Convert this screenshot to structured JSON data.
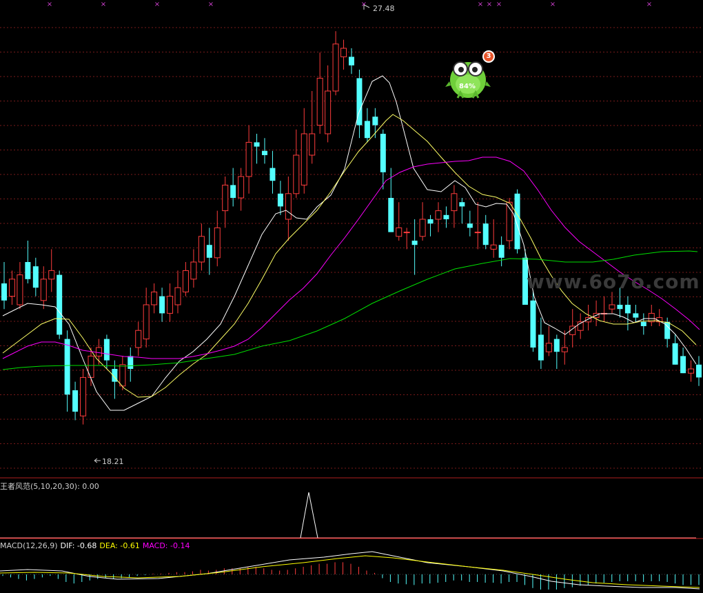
{
  "colors": {
    "up": "#ff3c3c",
    "down": "#54ffff",
    "ma5": "#ffffff",
    "ma10": "#ffff66",
    "ma20": "#ff00ff",
    "ma30": "#00e000",
    "grid": "#7a1a1a",
    "macd_dif": "#ffffff",
    "macd_dea": "#ffff00",
    "macd_label": "#ff00ff"
  },
  "price_axis": {
    "min": 17.0,
    "max": 28.0
  },
  "markers": {
    "high_label": "27.48",
    "low_label": "18.21"
  },
  "top_markers": [
    "×",
    "×",
    "×",
    "×",
    "×",
    "×",
    "×",
    "×",
    "×"
  ],
  "candles": [
    [
      21.5,
      21.1,
      22.0,
      20.9
    ],
    [
      21.2,
      21.6,
      21.8,
      21.0
    ],
    [
      21.0,
      21.7,
      22.0,
      20.9
    ],
    [
      22.0,
      21.6,
      22.5,
      21.5
    ],
    [
      21.9,
      21.4,
      22.1,
      21.2
    ],
    [
      21.1,
      21.6,
      21.9,
      20.9
    ],
    [
      21.6,
      21.8,
      22.3,
      21.3
    ],
    [
      21.7,
      20.3,
      21.8,
      20.2
    ],
    [
      20.2,
      18.9,
      20.4,
      18.5
    ],
    [
      19.0,
      18.5,
      19.2,
      18.3
    ],
    [
      18.4,
      19.3,
      19.5,
      18.2
    ],
    [
      19.3,
      19.8,
      20.0,
      19.1
    ],
    [
      19.8,
      20.0,
      20.2,
      19.6
    ],
    [
      20.2,
      19.7,
      20.3,
      19.5
    ],
    [
      19.5,
      19.2,
      19.7,
      18.8
    ],
    [
      19.1,
      19.6,
      19.8,
      19.0
    ],
    [
      19.8,
      19.5,
      20.0,
      19.2
    ],
    [
      20.0,
      20.4,
      20.6,
      19.8
    ],
    [
      20.2,
      21.0,
      21.4,
      20.0
    ],
    [
      21.0,
      21.3,
      21.5,
      20.8
    ],
    [
      21.2,
      20.8,
      21.4,
      20.6
    ],
    [
      20.8,
      21.2,
      21.5,
      20.6
    ],
    [
      21.0,
      21.4,
      21.8,
      20.8
    ],
    [
      21.3,
      21.8,
      22.0,
      21.2
    ],
    [
      21.6,
      22.0,
      22.3,
      21.4
    ],
    [
      22.0,
      22.6,
      22.9,
      21.8
    ],
    [
      22.4,
      22.1,
      22.8,
      21.7
    ],
    [
      22.1,
      22.8,
      23.2,
      21.9
    ],
    [
      23.2,
      23.8,
      24.0,
      22.8
    ],
    [
      23.8,
      23.5,
      24.2,
      23.3
    ],
    [
      23.5,
      24.0,
      24.2,
      23.2
    ],
    [
      24.0,
      24.8,
      25.2,
      23.6
    ],
    [
      24.8,
      24.7,
      25.0,
      24.3
    ],
    [
      24.6,
      24.5,
      24.9,
      24.3
    ],
    [
      24.2,
      23.9,
      24.6,
      23.6
    ],
    [
      23.6,
      23.3,
      23.9,
      23.1
    ],
    [
      23.0,
      23.6,
      24.0,
      22.5
    ],
    [
      23.6,
      24.5,
      25.1,
      23.5
    ],
    [
      23.8,
      25.0,
      25.6,
      23.6
    ],
    [
      24.5,
      25.0,
      26.0,
      24.3
    ],
    [
      25.2,
      26.3,
      26.9,
      25.0
    ],
    [
      25.0,
      26.0,
      26.6,
      24.8
    ],
    [
      26.0,
      27.1,
      27.4,
      25.9
    ],
    [
      26.8,
      27.0,
      27.2,
      26.5
    ],
    [
      26.8,
      26.6,
      27.0,
      26.4
    ],
    [
      26.3,
      25.2,
      26.5,
      24.9
    ],
    [
      25.3,
      24.9,
      25.6,
      24.8
    ],
    [
      25.4,
      25.2,
      25.6,
      24.9
    ],
    [
      25.0,
      24.1,
      25.1,
      23.7
    ],
    [
      23.5,
      22.7,
      24.2,
      22.7
    ],
    [
      22.6,
      22.8,
      23.4,
      22.5
    ],
    [
      22.7,
      22.7,
      22.8,
      22.3
    ],
    [
      22.5,
      22.4,
      23.0,
      21.7
    ],
    [
      22.6,
      23.0,
      23.4,
      22.5
    ],
    [
      23.0,
      22.9,
      23.1,
      22.6
    ],
    [
      23.0,
      23.2,
      23.4,
      22.7
    ],
    [
      23.1,
      23.0,
      23.3,
      22.8
    ],
    [
      23.2,
      23.6,
      23.8,
      22.8
    ],
    [
      23.4,
      23.3,
      23.5,
      22.9
    ],
    [
      22.9,
      22.8,
      23.2,
      22.6
    ],
    [
      22.7,
      22.7,
      23.4,
      22.3
    ],
    [
      22.9,
      22.4,
      23.1,
      22.3
    ],
    [
      22.3,
      22.4,
      23.0,
      22.1
    ],
    [
      22.4,
      22.1,
      22.6,
      21.9
    ],
    [
      22.5,
      23.4,
      23.5,
      22.3
    ],
    [
      23.6,
      22.3,
      23.7,
      22.2
    ],
    [
      22.1,
      21.0,
      22.3,
      21.0
    ],
    [
      21.1,
      20.0,
      21.3,
      19.9
    ],
    [
      20.3,
      19.7,
      20.7,
      19.5
    ],
    [
      19.9,
      20.1,
      20.5,
      19.8
    ],
    [
      20.2,
      19.9,
      20.3,
      19.5
    ],
    [
      19.9,
      20.0,
      20.4,
      19.6
    ],
    [
      20.3,
      20.5,
      20.9,
      20.0
    ],
    [
      20.4,
      20.6,
      20.8,
      20.2
    ],
    [
      20.6,
      20.7,
      21.0,
      20.4
    ],
    [
      20.7,
      20.8,
      21.1,
      20.5
    ],
    [
      20.8,
      20.8,
      21.2,
      20.6
    ],
    [
      20.9,
      21.0,
      21.3,
      20.8
    ],
    [
      21.0,
      20.9,
      21.4,
      20.7
    ],
    [
      21.0,
      20.8,
      21.2,
      20.4
    ],
    [
      20.8,
      20.7,
      21.0,
      20.6
    ],
    [
      20.6,
      20.5,
      20.8,
      20.3
    ],
    [
      20.6,
      20.8,
      21.0,
      20.5
    ],
    [
      20.6,
      20.7,
      20.9,
      20.5
    ],
    [
      20.6,
      20.2,
      20.7,
      20.0
    ],
    [
      20.1,
      19.6,
      20.3,
      19.6
    ],
    [
      19.8,
      19.4,
      20.0,
      19.4
    ],
    [
      19.4,
      19.5,
      19.7,
      19.2
    ],
    [
      19.6,
      19.3,
      19.8,
      19.1
    ]
  ],
  "ma_series": {
    "ma5": [
      [
        4,
        458
      ],
      [
        20,
        450
      ],
      [
        40,
        440
      ],
      [
        60,
        442
      ],
      [
        80,
        445
      ],
      [
        100,
        470
      ],
      [
        120,
        520
      ],
      [
        140,
        568
      ],
      [
        160,
        595
      ],
      [
        180,
        595
      ],
      [
        200,
        585
      ],
      [
        220,
        575
      ],
      [
        240,
        548
      ],
      [
        260,
        524
      ],
      [
        280,
        510
      ],
      [
        300,
        492
      ],
      [
        320,
        470
      ],
      [
        340,
        430
      ],
      [
        360,
        385
      ],
      [
        380,
        340
      ],
      [
        400,
        310
      ],
      [
        415,
        305
      ],
      [
        430,
        316
      ],
      [
        445,
        318
      ],
      [
        460,
        300
      ],
      [
        480,
        283
      ],
      [
        500,
        245
      ],
      [
        520,
        165
      ],
      [
        540,
        118
      ],
      [
        555,
        110
      ],
      [
        565,
        120
      ],
      [
        575,
        148
      ],
      [
        585,
        186
      ],
      [
        600,
        244
      ],
      [
        620,
        275
      ],
      [
        640,
        278
      ],
      [
        660,
        262
      ],
      [
        675,
        272
      ],
      [
        690,
        296
      ],
      [
        705,
        300
      ],
      [
        720,
        295
      ],
      [
        735,
        296
      ],
      [
        745,
        310
      ],
      [
        760,
        355
      ],
      [
        775,
        430
      ],
      [
        790,
        468
      ],
      [
        805,
        476
      ],
      [
        820,
        485
      ],
      [
        840,
        470
      ],
      [
        855,
        462
      ],
      [
        870,
        455
      ],
      [
        890,
        455
      ],
      [
        905,
        460
      ],
      [
        920,
        468
      ],
      [
        935,
        462
      ],
      [
        950,
        462
      ],
      [
        965,
        470
      ],
      [
        980,
        485
      ],
      [
        995,
        505
      ],
      [
        1010,
        528
      ]
    ],
    "ma10": [
      [
        4,
        512
      ],
      [
        20,
        500
      ],
      [
        40,
        485
      ],
      [
        60,
        470
      ],
      [
        80,
        462
      ],
      [
        100,
        463
      ],
      [
        120,
        490
      ],
      [
        140,
        520
      ],
      [
        160,
        540
      ],
      [
        180,
        563
      ],
      [
        200,
        576
      ],
      [
        220,
        575
      ],
      [
        240,
        562
      ],
      [
        260,
        544
      ],
      [
        280,
        528
      ],
      [
        300,
        514
      ],
      [
        320,
        492
      ],
      [
        340,
        470
      ],
      [
        360,
        440
      ],
      [
        380,
        405
      ],
      [
        400,
        368
      ],
      [
        420,
        345
      ],
      [
        440,
        325
      ],
      [
        460,
        305
      ],
      [
        480,
        278
      ],
      [
        500,
        248
      ],
      [
        520,
        220
      ],
      [
        540,
        198
      ],
      [
        560,
        175
      ],
      [
        570,
        166
      ],
      [
        585,
        175
      ],
      [
        600,
        188
      ],
      [
        620,
        205
      ],
      [
        640,
        228
      ],
      [
        660,
        250
      ],
      [
        680,
        270
      ],
      [
        700,
        282
      ],
      [
        720,
        286
      ],
      [
        740,
        295
      ],
      [
        755,
        318
      ],
      [
        770,
        345
      ],
      [
        785,
        375
      ],
      [
        800,
        400
      ],
      [
        815,
        422
      ],
      [
        830,
        440
      ],
      [
        850,
        455
      ],
      [
        870,
        465
      ],
      [
        890,
        470
      ],
      [
        910,
        470
      ],
      [
        930,
        466
      ],
      [
        950,
        465
      ],
      [
        970,
        468
      ],
      [
        990,
        480
      ],
      [
        1010,
        500
      ]
    ],
    "ma20": [
      [
        4,
        520
      ],
      [
        20,
        512
      ],
      [
        40,
        502
      ],
      [
        60,
        496
      ],
      [
        80,
        496
      ],
      [
        100,
        501
      ],
      [
        120,
        508
      ],
      [
        140,
        511
      ],
      [
        160,
        514
      ],
      [
        180,
        517
      ],
      [
        200,
        518
      ],
      [
        220,
        520
      ],
      [
        240,
        520
      ],
      [
        260,
        520
      ],
      [
        280,
        517
      ],
      [
        300,
        513
      ],
      [
        320,
        508
      ],
      [
        340,
        502
      ],
      [
        360,
        492
      ],
      [
        380,
        475
      ],
      [
        400,
        455
      ],
      [
        420,
        435
      ],
      [
        440,
        418
      ],
      [
        460,
        397
      ],
      [
        480,
        370
      ],
      [
        500,
        345
      ],
      [
        520,
        318
      ],
      [
        540,
        290
      ],
      [
        560,
        262
      ],
      [
        580,
        250
      ],
      [
        600,
        242
      ],
      [
        620,
        238
      ],
      [
        640,
        236
      ],
      [
        660,
        234
      ],
      [
        680,
        233
      ],
      [
        700,
        228
      ],
      [
        720,
        228
      ],
      [
        740,
        234
      ],
      [
        760,
        248
      ],
      [
        780,
        275
      ],
      [
        800,
        305
      ],
      [
        820,
        330
      ],
      [
        840,
        350
      ],
      [
        860,
        365
      ],
      [
        880,
        380
      ],
      [
        900,
        395
      ],
      [
        920,
        408
      ],
      [
        940,
        420
      ],
      [
        960,
        433
      ],
      [
        980,
        448
      ],
      [
        1000,
        464
      ],
      [
        1015,
        478
      ]
    ],
    "ma30": [
      [
        4,
        536
      ],
      [
        30,
        533
      ],
      [
        60,
        531
      ],
      [
        100,
        530
      ],
      [
        140,
        530
      ],
      [
        180,
        531
      ],
      [
        220,
        529
      ],
      [
        260,
        526
      ],
      [
        300,
        520
      ],
      [
        340,
        514
      ],
      [
        380,
        502
      ],
      [
        420,
        494
      ],
      [
        460,
        480
      ],
      [
        500,
        462
      ],
      [
        540,
        440
      ],
      [
        580,
        422
      ],
      [
        620,
        405
      ],
      [
        660,
        390
      ],
      [
        700,
        382
      ],
      [
        740,
        375
      ],
      [
        780,
        376
      ],
      [
        820,
        380
      ],
      [
        860,
        380
      ],
      [
        890,
        376
      ],
      [
        920,
        370
      ],
      [
        960,
        365
      ],
      [
        1000,
        364
      ],
      [
        1012,
        365
      ]
    ]
  },
  "signal_indicator": {
    "label": "王者风范(5,10,20,30)",
    "value_text": ": 0.00"
  },
  "macd": {
    "name": "MACD(12,26,9)",
    "dif_text": "DIF: -0.68",
    "dea_text": "DEA: -0.61",
    "macd_text": "MACD: -0.14",
    "bars": [
      -0.02,
      -0.04,
      -0.06,
      -0.08,
      -0.06,
      -0.04,
      -0.02,
      -0.06,
      -0.1,
      -0.12,
      -0.1,
      -0.08,
      -0.06,
      -0.05,
      -0.06,
      -0.05,
      -0.04,
      -0.02,
      -0.01,
      0.01,
      0.01,
      0.02,
      0.03,
      0.03,
      0.04,
      0.06,
      0.05,
      0.06,
      0.08,
      0.08,
      0.08,
      0.1,
      0.1,
      0.08,
      0.06,
      0.05,
      0.06,
      0.08,
      0.1,
      0.12,
      0.14,
      0.14,
      0.16,
      0.16,
      0.14,
      0.1,
      0.05,
      0.02,
      -0.05,
      -0.1,
      -0.12,
      -0.13,
      -0.14,
      -0.12,
      -0.12,
      -0.11,
      -0.1,
      -0.08,
      -0.08,
      -0.1,
      -0.1,
      -0.11,
      -0.11,
      -0.12,
      -0.1,
      -0.1,
      -0.14,
      -0.18,
      -0.2,
      -0.2,
      -0.2,
      -0.18,
      -0.17,
      -0.15,
      -0.14,
      -0.12,
      -0.11,
      -0.1,
      -0.09,
      -0.09,
      -0.09,
      -0.1,
      -0.09,
      -0.09,
      -0.1,
      -0.12,
      -0.14,
      -0.14,
      -0.14
    ]
  },
  "watermark": "www.6o7o.com",
  "overlay": {
    "percent": "84%",
    "badge": "3"
  }
}
